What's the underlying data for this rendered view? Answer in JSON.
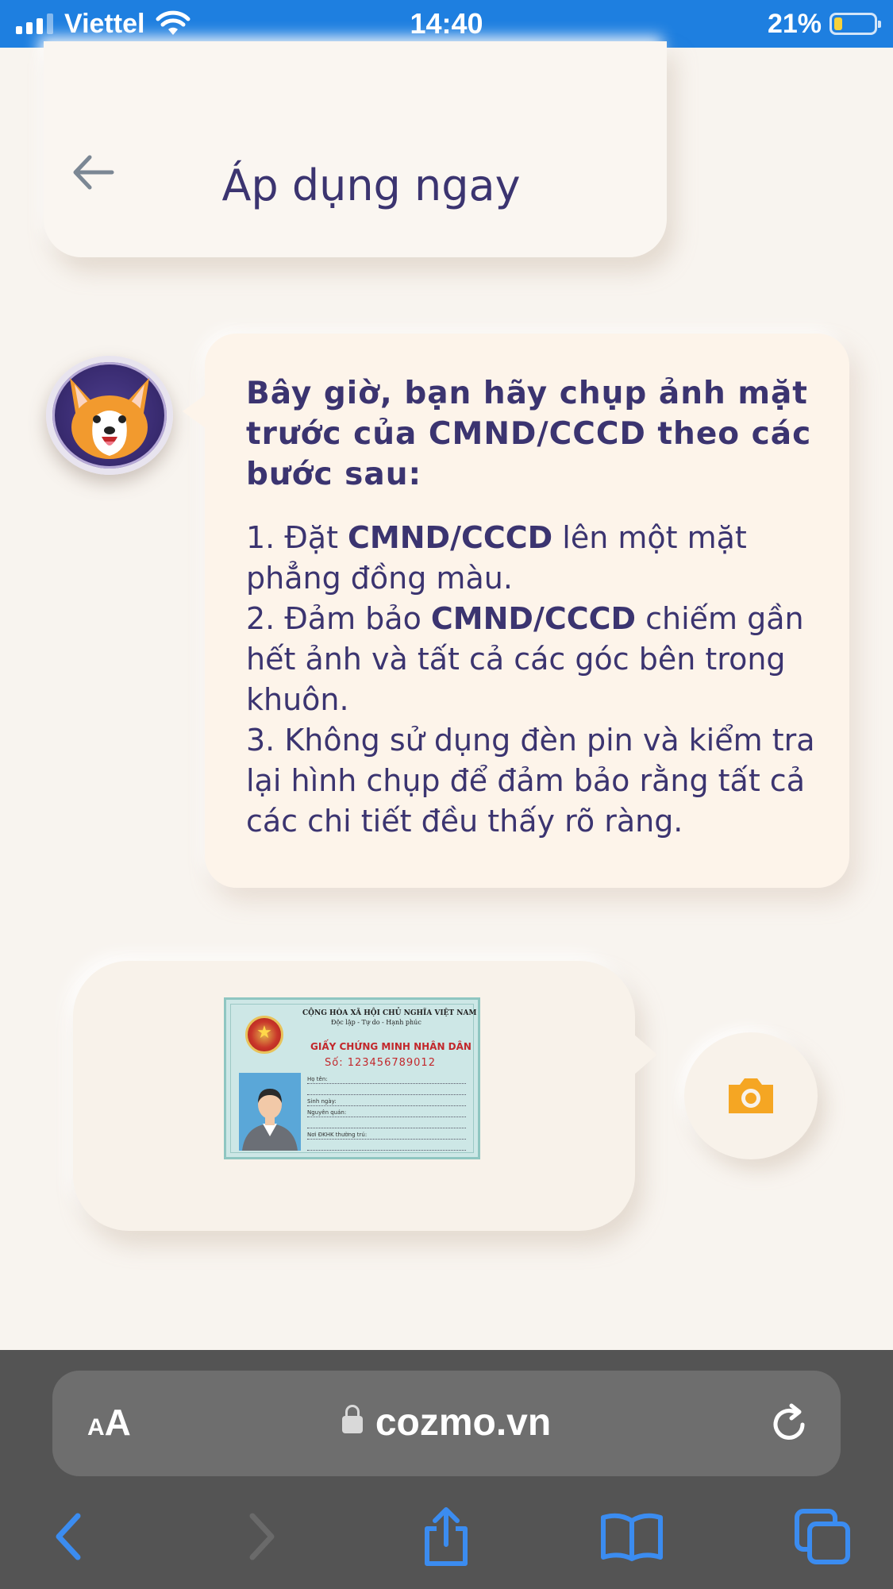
{
  "status_bar": {
    "carrier": "Viettel",
    "time": "14:40",
    "battery": "21%",
    "battery_level": 0.21
  },
  "header": {
    "title": "Áp dụng ngay"
  },
  "message": {
    "heading": "Bây giờ, bạn hãy chụp ảnh mặt trước của CMND/CCCD theo các bước sau:",
    "steps": [
      {
        "prefix": "1. Đặt ",
        "bold": "CMND/CCCD",
        "suffix": " lên một mặt phẳng đồng màu."
      },
      {
        "prefix": "2. Đảm bảo ",
        "bold": "CMND/CCCD",
        "suffix": " chiếm gần hết ảnh và tất cả các góc bên trong khuôn."
      },
      {
        "prefix": "3. Không sử dụng đèn pin và kiểm tra lại hình chụp để đảm bảo rằng tất cả các chi tiết đều thấy rõ ràng.",
        "bold": "",
        "suffix": ""
      }
    ]
  },
  "id_card": {
    "line1": "CỘNG HÒA XÃ HỘI CHỦ NGHĨA VIỆT NAM",
    "line2": "Độc lập - Tự do - Hạnh phúc",
    "card_title": "GIẤY CHỨNG MINH NHÂN DÂN",
    "number": "Số: 123456789012",
    "fields": [
      "Họ tên:",
      "",
      "Sinh ngày:",
      "Nguyên quán:",
      "",
      "Nơi ĐKHK thường trú:",
      ""
    ]
  },
  "browser": {
    "aa_label_small": "A",
    "aa_label_large": "A",
    "url": "cozmo.vn"
  },
  "colors": {
    "status_bar": "#1e7fe0",
    "text_primary": "#3b3470",
    "camera_icon": "#f5a623",
    "browser_icon": "#3b8cf0"
  },
  "icons": {
    "back": "arrow-left-icon",
    "camera": "camera-icon",
    "reload": "reload-icon",
    "nav_back": "chevron-left-icon",
    "nav_forward": "chevron-right-icon",
    "share": "share-icon",
    "bookmarks": "book-icon",
    "tabs": "tabs-icon"
  }
}
